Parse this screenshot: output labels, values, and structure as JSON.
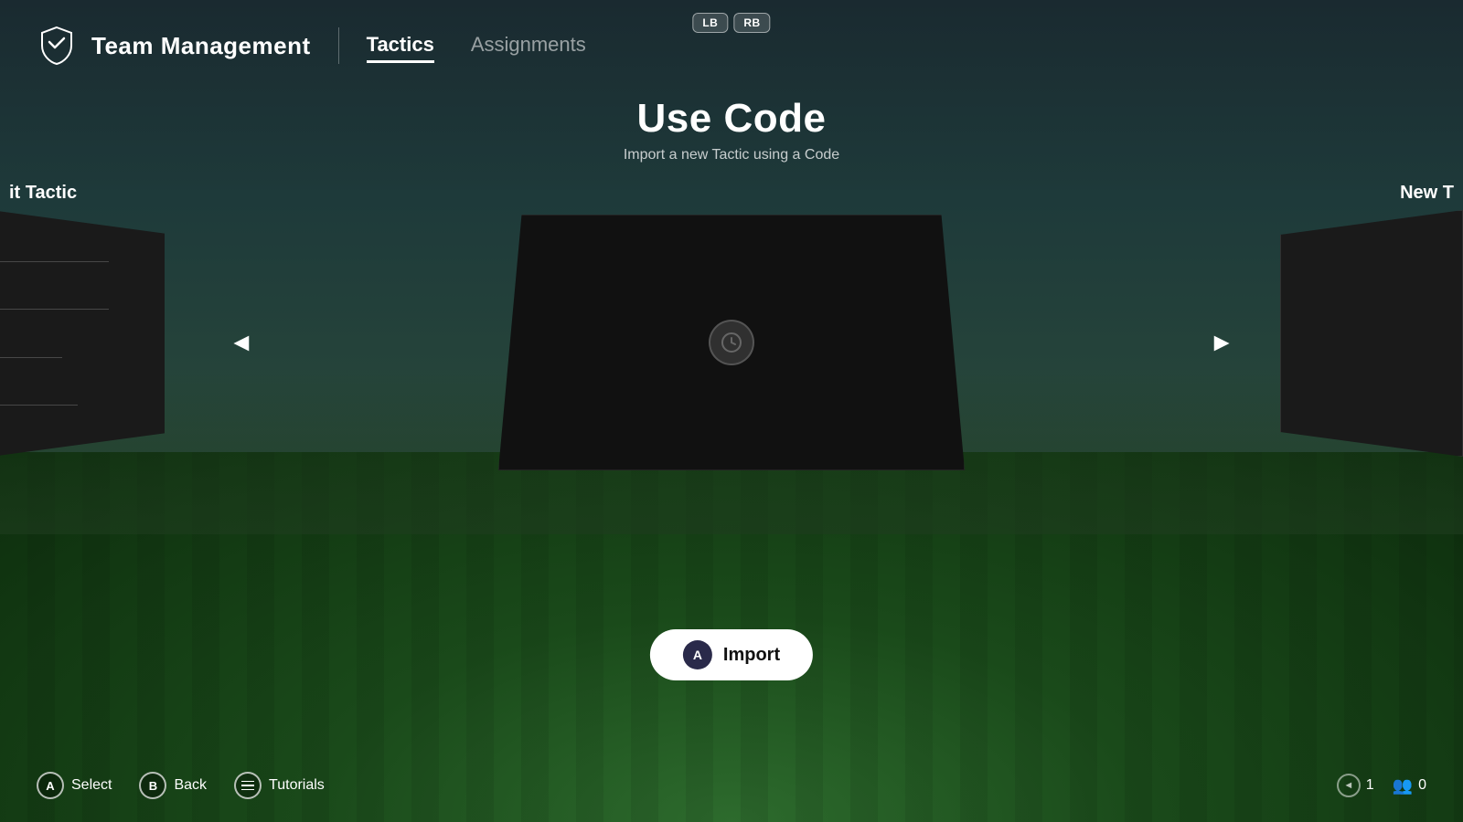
{
  "controller": {
    "lb": "LB",
    "rb": "RB"
  },
  "header": {
    "title": "Team Management",
    "nav": {
      "tactics": "Tactics",
      "assignments": "Assignments"
    }
  },
  "page": {
    "title": "Use Code",
    "subtitle": "Import a new Tactic using a Code"
  },
  "carousel": {
    "left_label": "it Tactic",
    "right_label": "New T",
    "arrow_left": "◄",
    "arrow_right": "►"
  },
  "import_button": {
    "a_label": "A",
    "label": "Import"
  },
  "bottom_bar": {
    "select_label": "Select",
    "back_label": "Back",
    "tutorials_label": "Tutorials",
    "a_btn": "A",
    "b_btn": "B",
    "nav_number": "1",
    "people_number": "0"
  }
}
